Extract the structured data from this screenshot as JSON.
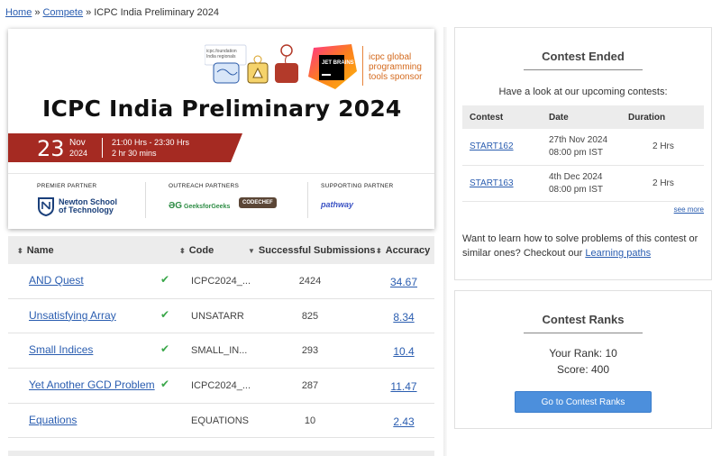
{
  "breadcrumb": {
    "home": "Home",
    "compete": "Compete",
    "current": "ICPC India Preliminary 2024",
    "sep": "»"
  },
  "banner": {
    "title": "ICPC India Preliminary 2024",
    "day": "23",
    "month": "Nov",
    "year": "2024",
    "time": "21:00 Hrs - 23:30 Hrs",
    "duration": "2 hr 30 mins",
    "icpc_foundation": "icpc.foundation",
    "icpc_regionals": "India regionals",
    "jetbrains": "JET BRAINS",
    "sponsor": [
      "icpc global",
      "programming",
      "tools sponsor"
    ],
    "premier_label": "PREMIER PARTNER",
    "premier_name": [
      "Newton School",
      "of Technology"
    ],
    "outreach_label": "OUTREACH PARTNERS",
    "outreach_gfg": "GeeksforGeeks",
    "outreach_codechef": "CODECHEF",
    "supporting_label": "SUPPORTING PARTNER",
    "supporting_name": "pathway",
    "colors": {
      "ribbon": "#a52a22",
      "sponsor": "#d46a1e"
    }
  },
  "problems": {
    "headers": {
      "name": "Name",
      "code": "Code",
      "subs": "Successful Submissions",
      "acc": "Accuracy"
    },
    "sort_icon": "⬍",
    "code_sort_icon": "▼",
    "rows": [
      {
        "name": "AND Quest",
        "solved": true,
        "code": "ICPC2024_...",
        "subs": "2424",
        "acc": "34.67"
      },
      {
        "name": "Unsatisfying Array",
        "solved": true,
        "code": "UNSATARR",
        "subs": "825",
        "acc": "8.34"
      },
      {
        "name": "Small Indices",
        "solved": true,
        "code": "SMALL_IN...",
        "subs": "293",
        "acc": "10.4"
      },
      {
        "name": "Yet Another GCD Problem",
        "solved": true,
        "code": "ICPC2024_...",
        "subs": "287",
        "acc": "11.47"
      },
      {
        "name": "Equations",
        "solved": false,
        "code": "EQUATIONS",
        "subs": "10",
        "acc": "2.43"
      }
    ],
    "check_icon": "✔"
  },
  "contest_ended": {
    "title": "Contest Ended",
    "note": "Have a look at our upcoming contests:",
    "headers": {
      "contest": "Contest",
      "date": "Date",
      "duration": "Duration"
    },
    "rows": [
      {
        "contest": "START162",
        "date": "27th Nov 2024",
        "time": "08:00 pm IST",
        "duration": "2 Hrs"
      },
      {
        "contest": "START163",
        "date": "4th Dec 2024",
        "time": "08:00 pm IST",
        "duration": "2 Hrs"
      }
    ],
    "see_more": "see more",
    "learn_text": "Want to learn how to solve problems of this contest or similar ones? Checkout our ",
    "learn_link": "Learning paths"
  },
  "contest_ranks": {
    "title": "Contest Ranks",
    "rank": "Your Rank: 10",
    "score": "Score: 400",
    "button": "Go to Contest Ranks"
  }
}
